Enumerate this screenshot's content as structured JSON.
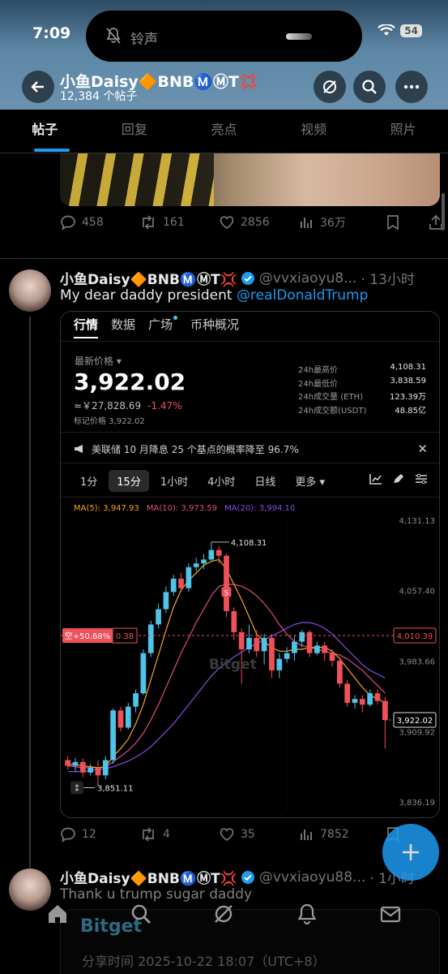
{
  "status_bar": {
    "time": "7:09",
    "island_text": "铃声",
    "battery": "54"
  },
  "header": {
    "title": "小鱼Daisy🔶BNBⓂ️ⓂT💢",
    "post_count": "12,384 个帖子"
  },
  "tabs": [
    "帖子",
    "回复",
    "亮点",
    "视频",
    "照片"
  ],
  "prev_post": {
    "replies": "458",
    "reposts": "161",
    "likes": "2856",
    "views": "36万"
  },
  "post1": {
    "name": "小鱼Daisy🔶BNBⓂ️ⓂT💢",
    "handle": "@vvxiaoyu8...",
    "time": "· 13小时",
    "text": "My dear daddy president ",
    "mention": "@realDonaldTrump",
    "replies": "12",
    "reposts": "4",
    "likes": "35",
    "views": "7852"
  },
  "embed": {
    "tabs": [
      "行情",
      "数据",
      "广场",
      "币种概况"
    ],
    "price_label": "最新价格 ▾",
    "price": "3,922.02",
    "price_cny": "≈￥27,828.69",
    "price_change": "-1.47%",
    "mark_price": "标记价格 3,922.02",
    "stats": [
      {
        "k": "24h最高价",
        "v": "4,108.31"
      },
      {
        "k": "24h最低价",
        "v": "3,838.59"
      },
      {
        "k": "24h成交量 (ETH)",
        "v": "123.39万"
      },
      {
        "k": "24h成交额(USDT)",
        "v": "48.85亿"
      }
    ],
    "notice": "美联储 10 月降息 25 个基点的概率降至 96.7%",
    "timeframes": [
      "1分",
      "15分",
      "1小时",
      "4小时",
      "日线",
      "更多 ▾"
    ],
    "ma5": "MA(5): 3,947.93",
    "ma10": "MA(10): 3,973.59",
    "ma20": "MA(20): 3,994.10",
    "short_tag": "空+50.68%",
    "short_qty": "0.38",
    "watermark": "Bitget",
    "colors": {
      "up": "#4fc3e8",
      "down": "#f0505a",
      "ma5": "#f5a623",
      "ma10": "#e04b8a",
      "ma20": "#8a4be0"
    }
  },
  "chart_data": {
    "type": "candlestick",
    "y_axis_ticks": [
      "4,131.13",
      "4,057.40",
      "3,983.66",
      "3,909.92",
      "3,836.19"
    ],
    "ylim": [
      3836.19,
      4131.13
    ],
    "high_label": "4,108.31",
    "low_label": "3,851.11",
    "position_line": "4,010.39",
    "last_price": "3,922.02",
    "candles": [
      {
        "o": 3880,
        "c": 3874,
        "h": 3884,
        "l": 3870
      },
      {
        "o": 3874,
        "c": 3878,
        "h": 3882,
        "l": 3868
      },
      {
        "o": 3878,
        "c": 3867,
        "h": 3882,
        "l": 3862
      },
      {
        "o": 3867,
        "c": 3872,
        "h": 3876,
        "l": 3864
      },
      {
        "o": 3872,
        "c": 3864,
        "h": 3880,
        "l": 3852
      },
      {
        "o": 3864,
        "c": 3880,
        "h": 3884,
        "l": 3860
      },
      {
        "o": 3880,
        "c": 3932,
        "h": 3934,
        "l": 3876
      },
      {
        "o": 3932,
        "c": 3914,
        "h": 3936,
        "l": 3910
      },
      {
        "o": 3914,
        "c": 3936,
        "h": 3940,
        "l": 3912
      },
      {
        "o": 3936,
        "c": 3950,
        "h": 3954,
        "l": 3930
      },
      {
        "o": 3950,
        "c": 3992,
        "h": 3996,
        "l": 3948
      },
      {
        "o": 3992,
        "c": 4022,
        "h": 4026,
        "l": 3988
      },
      {
        "o": 4022,
        "c": 4038,
        "h": 4044,
        "l": 4018
      },
      {
        "o": 4038,
        "c": 4056,
        "h": 4062,
        "l": 4034
      },
      {
        "o": 4056,
        "c": 4070,
        "h": 4074,
        "l": 4052
      },
      {
        "o": 4070,
        "c": 4060,
        "h": 4076,
        "l": 4056
      },
      {
        "o": 4060,
        "c": 4082,
        "h": 4086,
        "l": 4056
      },
      {
        "o": 4082,
        "c": 4086,
        "h": 4092,
        "l": 4078
      },
      {
        "o": 4086,
        "c": 4090,
        "h": 4096,
        "l": 4080
      },
      {
        "o": 4090,
        "c": 4100,
        "h": 4108.31,
        "l": 4088
      },
      {
        "o": 4100,
        "c": 4094,
        "h": 4104,
        "l": 4086
      },
      {
        "o": 4094,
        "c": 4036,
        "h": 4096,
        "l": 4030
      },
      {
        "o": 4036,
        "c": 4014,
        "h": 4040,
        "l": 4006
      },
      {
        "o": 4014,
        "c": 3996,
        "h": 4018,
        "l": 3960
      },
      {
        "o": 3996,
        "c": 4008,
        "h": 4022,
        "l": 3992
      },
      {
        "o": 4008,
        "c": 3994,
        "h": 4016,
        "l": 3988
      },
      {
        "o": 3994,
        "c": 4008,
        "h": 4012,
        "l": 3980
      },
      {
        "o": 4008,
        "c": 3974,
        "h": 4012,
        "l": 3966
      },
      {
        "o": 3974,
        "c": 3986,
        "h": 3992,
        "l": 3966
      },
      {
        "o": 3986,
        "c": 3992,
        "h": 3998,
        "l": 3982
      },
      {
        "o": 3992,
        "c": 4004,
        "h": 4010,
        "l": 3984
      },
      {
        "o": 4004,
        "c": 4014,
        "h": 4016,
        "l": 3998
      },
      {
        "o": 4014,
        "c": 3992,
        "h": 4016,
        "l": 3988
      },
      {
        "o": 3992,
        "c": 4000,
        "h": 4004,
        "l": 3990
      },
      {
        "o": 4000,
        "c": 3992,
        "h": 4004,
        "l": 3984
      },
      {
        "o": 3992,
        "c": 3984,
        "h": 3996,
        "l": 3978
      },
      {
        "o": 3984,
        "c": 3960,
        "h": 3988,
        "l": 3956
      },
      {
        "o": 3960,
        "c": 3940,
        "h": 3964,
        "l": 3936
      },
      {
        "o": 3940,
        "c": 3944,
        "h": 3948,
        "l": 3934
      },
      {
        "o": 3944,
        "c": 3938,
        "h": 3948,
        "l": 3930
      },
      {
        "o": 3938,
        "c": 3950,
        "h": 3954,
        "l": 3936
      },
      {
        "o": 3950,
        "c": 3942,
        "h": 3954,
        "l": 3938
      },
      {
        "o": 3942,
        "c": 3922,
        "h": 3946,
        "l": 3892
      }
    ],
    "ma5_line": [
      3876,
      3875,
      3874,
      3873,
      3872,
      3873,
      3884,
      3892,
      3902,
      3918,
      3938,
      3964,
      3990,
      4016,
      4040,
      4058,
      4068,
      4076,
      4084,
      4088,
      4090,
      4080,
      4064,
      4048,
      4030,
      4012,
      4004,
      3998,
      3994,
      3994,
      3996,
      3996,
      3998,
      3998,
      3998,
      3994,
      3986,
      3976,
      3966,
      3956,
      3948,
      3944,
      3940
    ],
    "ma10_line": [
      3874,
      3873,
      3872,
      3872,
      3872,
      3873,
      3878,
      3884,
      3890,
      3898,
      3908,
      3922,
      3938,
      3956,
      3974,
      3992,
      4008,
      4024,
      4038,
      4052,
      4062,
      4064,
      4064,
      4062,
      4058,
      4052,
      4044,
      4034,
      4022,
      4012,
      4004,
      4000,
      3998,
      3996,
      3994,
      3992,
      3990,
      3986,
      3980,
      3974,
      3966,
      3958,
      3950
    ],
    "ma20_line": [
      3868,
      3868,
      3868,
      3869,
      3870,
      3871,
      3873,
      3876,
      3879,
      3883,
      3888,
      3894,
      3902,
      3910,
      3918,
      3928,
      3938,
      3948,
      3958,
      3968,
      3976,
      3982,
      3988,
      3993,
      3998,
      4002,
      4006,
      4010,
      4014,
      4018,
      4022,
      4024,
      4024,
      4022,
      4018,
      4012,
      4004,
      3996,
      3988,
      3980,
      3974,
      3970,
      3966
    ]
  },
  "post2": {
    "name": "小鱼Daisy🔶BNBⓂ️ⓂT💢",
    "handle": "@vvxiaoyu88...",
    "time": "· 1小时",
    "text": "Thank u trump sugar daddy"
  },
  "share_card": {
    "logo": "Bitget",
    "time": "分享时间 2025-10-22 18:07（UTC+8）"
  }
}
